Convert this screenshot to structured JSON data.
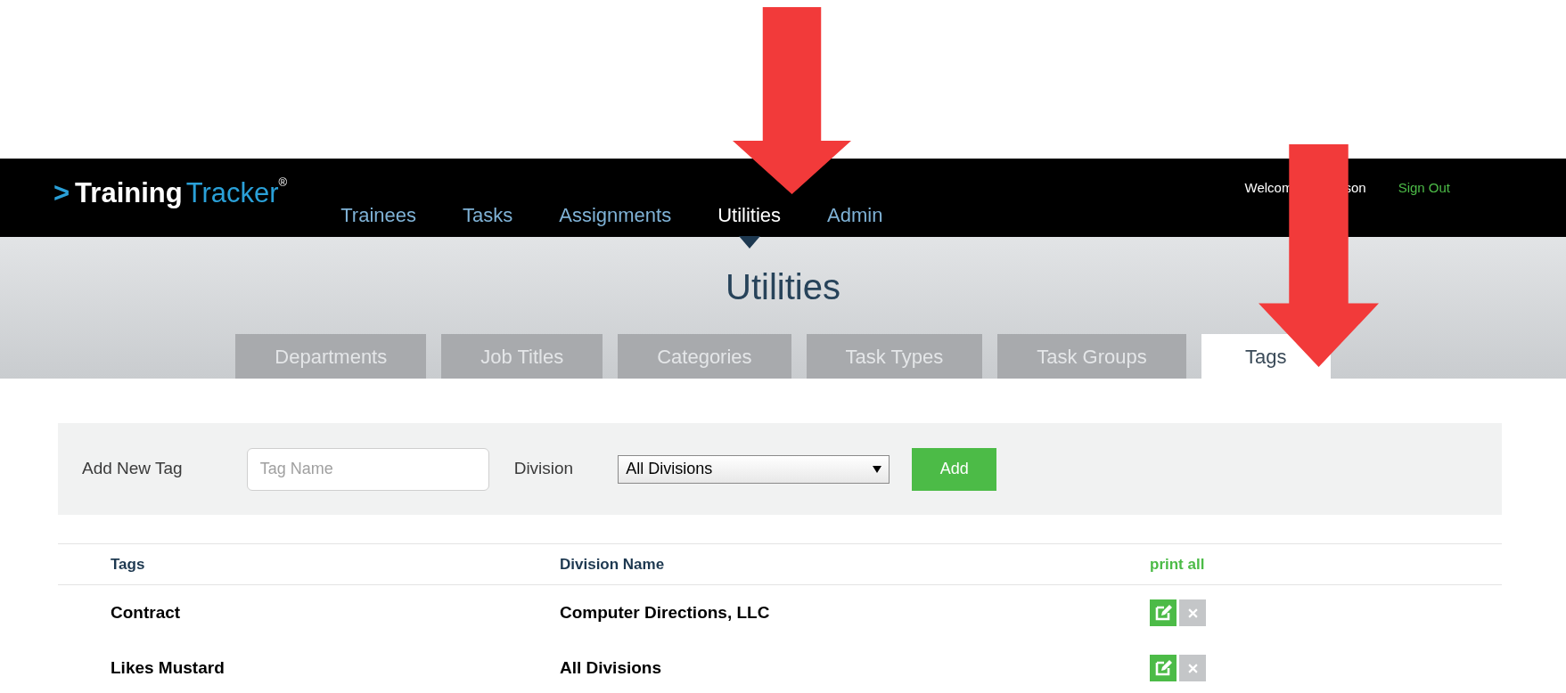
{
  "logo": {
    "prefix": ">",
    "brand_bold": "Training",
    "brand_light": "Tracker",
    "mark": "®"
  },
  "nav": [
    {
      "label": "Trainees",
      "selected": false
    },
    {
      "label": "Tasks",
      "selected": false
    },
    {
      "label": "Assignments",
      "selected": false
    },
    {
      "label": "Utilities",
      "selected": true
    },
    {
      "label": "Admin",
      "selected": false
    }
  ],
  "user": {
    "welcome_left": "Welcom",
    "welcome_right": "son",
    "sign_out": "Sign Out"
  },
  "page_title": "Utilities",
  "tabs": [
    {
      "label": "Departments",
      "selected": false
    },
    {
      "label": "Job Titles",
      "selected": false
    },
    {
      "label": "Categories",
      "selected": false
    },
    {
      "label": "Task Types",
      "selected": false
    },
    {
      "label": "Task Groups",
      "selected": false
    },
    {
      "label": "Tags",
      "selected": true
    }
  ],
  "add_form": {
    "label": "Add New Tag",
    "placeholder": "Tag Name",
    "division_label": "Division",
    "division_value": "All Divisions",
    "button": "Add"
  },
  "table": {
    "columns": [
      "Tags",
      "Division Name"
    ],
    "print_all": "print all",
    "rows": [
      {
        "tag": "Contract",
        "division": "Computer Directions, LLC"
      },
      {
        "tag": "Likes Mustard",
        "division": "All Divisions"
      }
    ]
  }
}
